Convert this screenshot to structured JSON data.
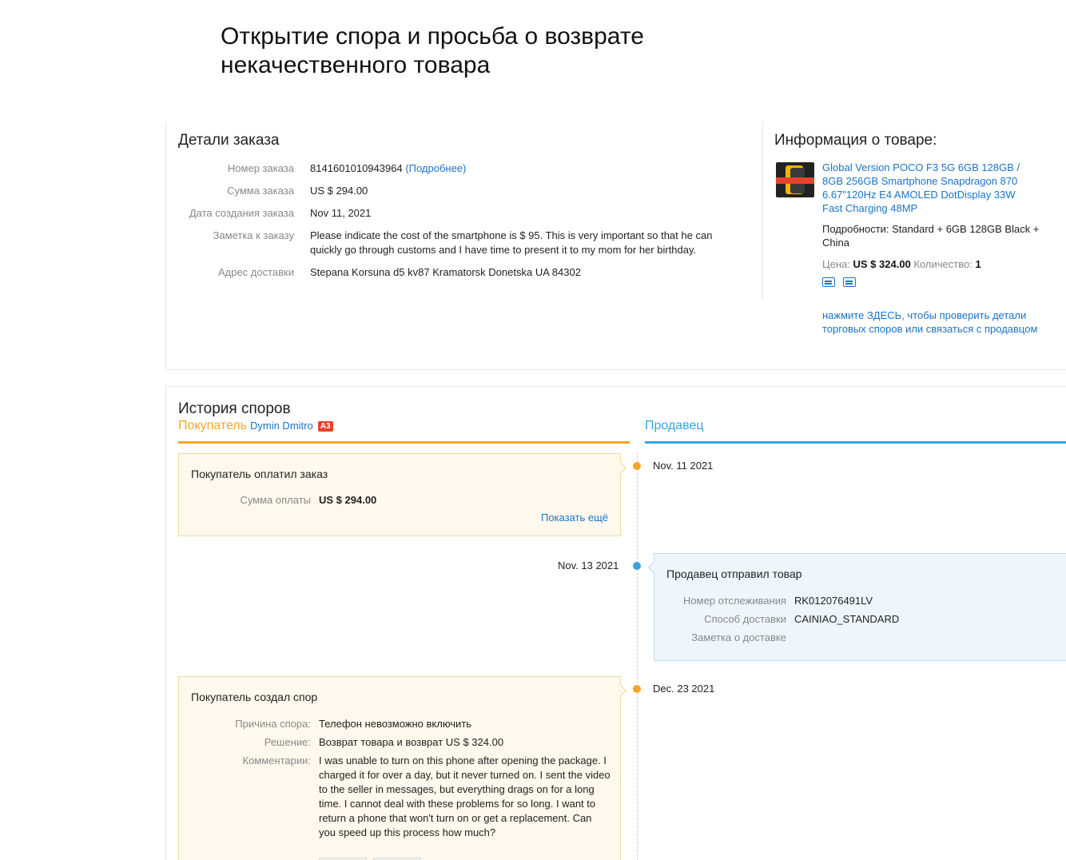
{
  "page_title": "Открытие спора и просьба о возврате некачественного товара",
  "order": {
    "heading": "Детали заказа",
    "rows": [
      {
        "label": "Номер заказа",
        "value": "8141601010943964",
        "link": "(Подробнее)"
      },
      {
        "label": "Сумма заказа",
        "value": "US $ 294.00"
      },
      {
        "label": "Дата создания заказа",
        "value": "Nov 11, 2021"
      },
      {
        "label": "Заметка к заказу",
        "value": "Please indicate the cost of the smartphone is $ 95. This is very important so that he can quickly go through customs and I have time to present it to my mom for her birthday."
      },
      {
        "label": "Адрес доставки",
        "value": "Stepana Korsuna d5 kv87 Kramatorsk Donetska UA 84302"
      }
    ]
  },
  "product": {
    "heading": "Информация о товаре:",
    "title": "Global Version POCO F3 5G 6GB 128GB / 8GB 256GB Smartphone Snapdragon 870 6.67\"120Hz E4 AMOLED DotDisplay 33W Fast Charging 48MP",
    "props": "Подробности: Standard + 6GB 128GB Black + China",
    "price_label": "Цена:",
    "price": "US $ 324.00",
    "qty_label": "Количество:",
    "qty": "1",
    "icons": [
      "shipping-icon",
      "invoice-icon"
    ],
    "seller_link": "нажмите ЗДЕСЬ, чтобы проверить детали торговых споров или связаться с продавцом"
  },
  "history": {
    "heading": "История споров",
    "buyer_tab": "Покупатель",
    "buyer_name": "Dymin Dmitro",
    "buyer_badge": "A3",
    "seller_tab": "Продавец",
    "colors": {
      "buyer": "#f5a623",
      "seller": "#36a3e0"
    },
    "events": [
      {
        "side": "buyer",
        "date": "Nov. 11 2021",
        "title": "Покупатель оплатил заказ",
        "rows": [
          {
            "label": "Сумма оплаты",
            "value": "US $ 294.00"
          }
        ],
        "show_more": "Показать ещё"
      },
      {
        "side": "seller",
        "date": "Nov. 13 2021",
        "title": "Продавец отправил товар",
        "rows": [
          {
            "label": "Номер отслеживания",
            "value": "RK012076491LV"
          },
          {
            "label": "Способ доставки",
            "value": "CAINIAO_STANDARD"
          },
          {
            "label": "Заметка о доставке",
            "value": ""
          }
        ]
      },
      {
        "side": "buyer",
        "date": "Dec. 23 2021",
        "title": "Покупатель создал спор",
        "rows": [
          {
            "label": "Причина спора:",
            "value": "Телефон невозможно включить"
          },
          {
            "label": "Решение:",
            "value": "Возврат товара и возврат US $ 324.00"
          },
          {
            "label": "Комментарии:",
            "value": "I was unable to turn on this phone after opening the package. I charged it for over a day, but it never turned on. I sent the video to the seller in messages, but everything drags on for a long time. I cannot deal with these problems for so long. I want to return a phone that won't turn on or get a replacement. Can you speed up this process how much?"
          }
        ]
      }
    ]
  }
}
